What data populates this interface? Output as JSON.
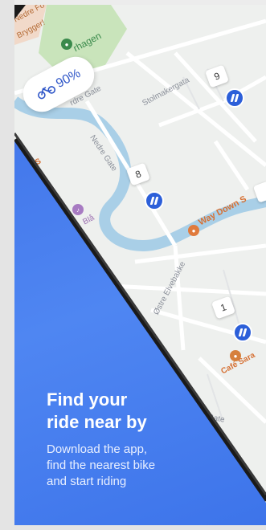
{
  "map": {
    "battery": {
      "icon": "bike-icon",
      "percent": "90%"
    },
    "labels": {
      "nedre_fo": "Nedre Fo",
      "brygger": "Brygger!",
      "hagen": "rhagen",
      "nedre_gate": "Nedre Gate",
      "nedre_gate2": "rdre Gate",
      "stolmakergata": "Stolmakergata",
      "ata": "ata",
      "rud_as": "rud AS",
      "bla": "Blå",
      "way_down_s": "Way Down S",
      "ostre_elvebakke": "Østre Elvebakke",
      "cafe_sara": "Café Sara",
      "gate": "Gate"
    },
    "bubbles": [
      "9",
      "8",
      "1"
    ]
  },
  "promo": {
    "headline_line1": "Find your",
    "headline_line2": "ride near by",
    "sub_line1": "Download the app,",
    "sub_line2": "find the nearest bike",
    "sub_line3": "and start riding"
  },
  "colors": {
    "accent": "#2c5fd9",
    "panel": "#4f86f2",
    "river": "#a9cfe7",
    "park": "#c7e3b9"
  }
}
